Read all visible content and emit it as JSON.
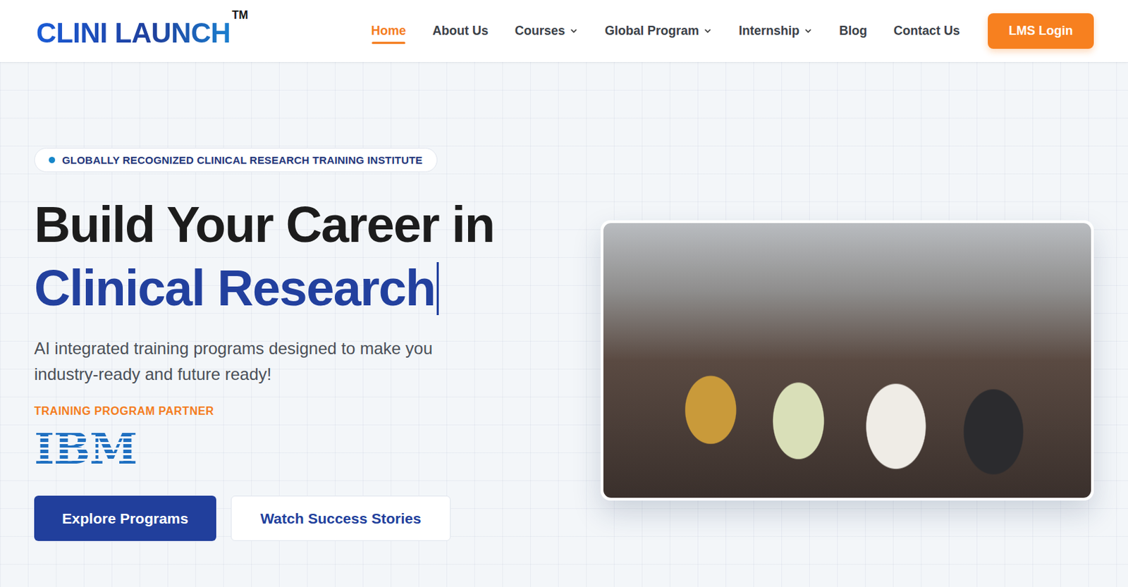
{
  "header": {
    "logo": {
      "text": "CLINI LAUNCH",
      "mark": "TM"
    },
    "nav": [
      {
        "label": "Home",
        "selected": true,
        "kind": "link"
      },
      {
        "label": "About Us",
        "selected": false,
        "kind": "link"
      },
      {
        "label": "Courses",
        "selected": false,
        "kind": "dropdown"
      },
      {
        "label": "Global Program",
        "selected": false,
        "kind": "dropdown"
      },
      {
        "label": "Internship",
        "selected": false,
        "kind": "dropdown"
      },
      {
        "label": "Blog",
        "selected": false,
        "kind": "link"
      },
      {
        "label": "Contact Us",
        "selected": false,
        "kind": "link"
      }
    ],
    "cta": "LMS Login"
  },
  "hero": {
    "badge": "GLOBALLY RECOGNIZED CLINICAL RESEARCH TRAINING INSTITUTE",
    "title_line1": "Build Your Career in",
    "title_line2": "Clinical Research",
    "typing_cursor": true,
    "subtitle": "AI integrated training programs designed to make you industry-ready and future ready!",
    "partner_label": "TRAINING PROGRAM PARTNER",
    "partner_logo": "IBM",
    "buttons": [
      {
        "label": "Explore Programs",
        "kind": "primary"
      },
      {
        "label": "Watch Success Stories",
        "kind": "secondary"
      }
    ]
  }
}
